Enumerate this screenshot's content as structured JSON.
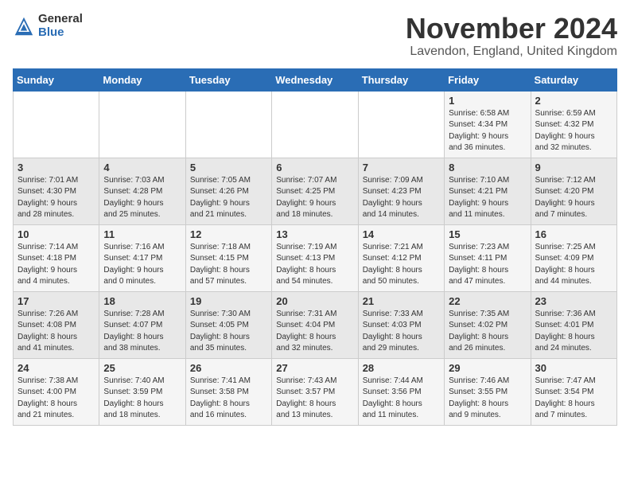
{
  "header": {
    "logo_general": "General",
    "logo_blue": "Blue",
    "month": "November 2024",
    "location": "Lavendon, England, United Kingdom"
  },
  "days_of_week": [
    "Sunday",
    "Monday",
    "Tuesday",
    "Wednesday",
    "Thursday",
    "Friday",
    "Saturday"
  ],
  "weeks": [
    [
      {
        "day": "",
        "info": ""
      },
      {
        "day": "",
        "info": ""
      },
      {
        "day": "",
        "info": ""
      },
      {
        "day": "",
        "info": ""
      },
      {
        "day": "",
        "info": ""
      },
      {
        "day": "1",
        "info": "Sunrise: 6:58 AM\nSunset: 4:34 PM\nDaylight: 9 hours\nand 36 minutes."
      },
      {
        "day": "2",
        "info": "Sunrise: 6:59 AM\nSunset: 4:32 PM\nDaylight: 9 hours\nand 32 minutes."
      }
    ],
    [
      {
        "day": "3",
        "info": "Sunrise: 7:01 AM\nSunset: 4:30 PM\nDaylight: 9 hours\nand 28 minutes."
      },
      {
        "day": "4",
        "info": "Sunrise: 7:03 AM\nSunset: 4:28 PM\nDaylight: 9 hours\nand 25 minutes."
      },
      {
        "day": "5",
        "info": "Sunrise: 7:05 AM\nSunset: 4:26 PM\nDaylight: 9 hours\nand 21 minutes."
      },
      {
        "day": "6",
        "info": "Sunrise: 7:07 AM\nSunset: 4:25 PM\nDaylight: 9 hours\nand 18 minutes."
      },
      {
        "day": "7",
        "info": "Sunrise: 7:09 AM\nSunset: 4:23 PM\nDaylight: 9 hours\nand 14 minutes."
      },
      {
        "day": "8",
        "info": "Sunrise: 7:10 AM\nSunset: 4:21 PM\nDaylight: 9 hours\nand 11 minutes."
      },
      {
        "day": "9",
        "info": "Sunrise: 7:12 AM\nSunset: 4:20 PM\nDaylight: 9 hours\nand 7 minutes."
      }
    ],
    [
      {
        "day": "10",
        "info": "Sunrise: 7:14 AM\nSunset: 4:18 PM\nDaylight: 9 hours\nand 4 minutes."
      },
      {
        "day": "11",
        "info": "Sunrise: 7:16 AM\nSunset: 4:17 PM\nDaylight: 9 hours\nand 0 minutes."
      },
      {
        "day": "12",
        "info": "Sunrise: 7:18 AM\nSunset: 4:15 PM\nDaylight: 8 hours\nand 57 minutes."
      },
      {
        "day": "13",
        "info": "Sunrise: 7:19 AM\nSunset: 4:13 PM\nDaylight: 8 hours\nand 54 minutes."
      },
      {
        "day": "14",
        "info": "Sunrise: 7:21 AM\nSunset: 4:12 PM\nDaylight: 8 hours\nand 50 minutes."
      },
      {
        "day": "15",
        "info": "Sunrise: 7:23 AM\nSunset: 4:11 PM\nDaylight: 8 hours\nand 47 minutes."
      },
      {
        "day": "16",
        "info": "Sunrise: 7:25 AM\nSunset: 4:09 PM\nDaylight: 8 hours\nand 44 minutes."
      }
    ],
    [
      {
        "day": "17",
        "info": "Sunrise: 7:26 AM\nSunset: 4:08 PM\nDaylight: 8 hours\nand 41 minutes."
      },
      {
        "day": "18",
        "info": "Sunrise: 7:28 AM\nSunset: 4:07 PM\nDaylight: 8 hours\nand 38 minutes."
      },
      {
        "day": "19",
        "info": "Sunrise: 7:30 AM\nSunset: 4:05 PM\nDaylight: 8 hours\nand 35 minutes."
      },
      {
        "day": "20",
        "info": "Sunrise: 7:31 AM\nSunset: 4:04 PM\nDaylight: 8 hours\nand 32 minutes."
      },
      {
        "day": "21",
        "info": "Sunrise: 7:33 AM\nSunset: 4:03 PM\nDaylight: 8 hours\nand 29 minutes."
      },
      {
        "day": "22",
        "info": "Sunrise: 7:35 AM\nSunset: 4:02 PM\nDaylight: 8 hours\nand 26 minutes."
      },
      {
        "day": "23",
        "info": "Sunrise: 7:36 AM\nSunset: 4:01 PM\nDaylight: 8 hours\nand 24 minutes."
      }
    ],
    [
      {
        "day": "24",
        "info": "Sunrise: 7:38 AM\nSunset: 4:00 PM\nDaylight: 8 hours\nand 21 minutes."
      },
      {
        "day": "25",
        "info": "Sunrise: 7:40 AM\nSunset: 3:59 PM\nDaylight: 8 hours\nand 18 minutes."
      },
      {
        "day": "26",
        "info": "Sunrise: 7:41 AM\nSunset: 3:58 PM\nDaylight: 8 hours\nand 16 minutes."
      },
      {
        "day": "27",
        "info": "Sunrise: 7:43 AM\nSunset: 3:57 PM\nDaylight: 8 hours\nand 13 minutes."
      },
      {
        "day": "28",
        "info": "Sunrise: 7:44 AM\nSunset: 3:56 PM\nDaylight: 8 hours\nand 11 minutes."
      },
      {
        "day": "29",
        "info": "Sunrise: 7:46 AM\nSunset: 3:55 PM\nDaylight: 8 hours\nand 9 minutes."
      },
      {
        "day": "30",
        "info": "Sunrise: 7:47 AM\nSunset: 3:54 PM\nDaylight: 8 hours\nand 7 minutes."
      }
    ]
  ]
}
